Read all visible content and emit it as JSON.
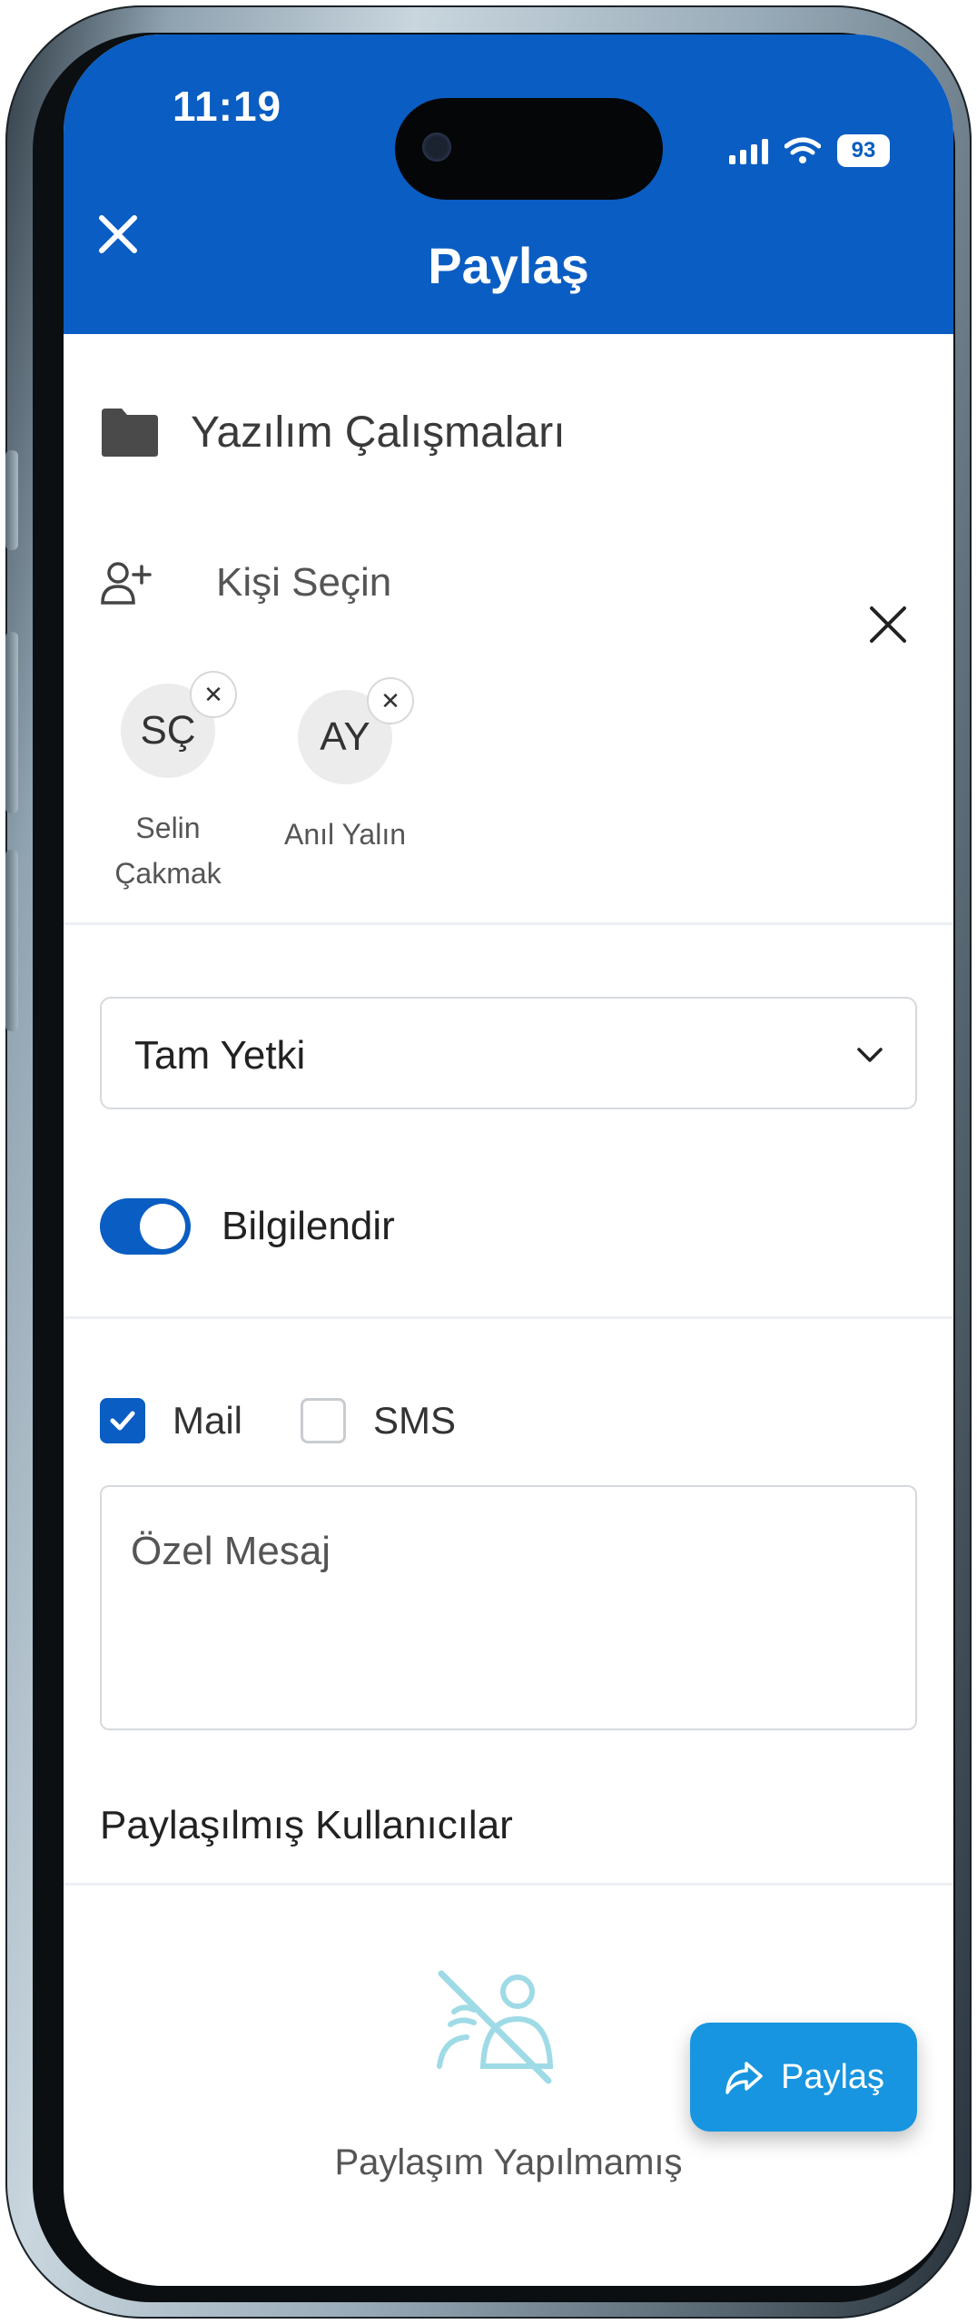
{
  "status_bar": {
    "time": "11:19",
    "battery": "93"
  },
  "header": {
    "title": "Paylaş"
  },
  "folder": {
    "name": "Yazılım Çalışmaları"
  },
  "recipients": {
    "select_label": "Kişi Seçin",
    "selected": [
      {
        "initials": "SÇ",
        "name_line1": "Selin",
        "name_line2": "Çakmak"
      },
      {
        "initials": "AY",
        "name_line1": "Anıl Yalın",
        "name_line2": ""
      }
    ]
  },
  "permission": {
    "selected": "Tam Yetki"
  },
  "notify": {
    "label": "Bilgilendir",
    "enabled": true
  },
  "channels": [
    {
      "label": "Mail",
      "checked": true
    },
    {
      "label": "SMS",
      "checked": false
    }
  ],
  "message": {
    "placeholder": "Özel Mesaj"
  },
  "shared_users": {
    "title": "Paylaşılmış Kullanıcılar",
    "empty_text": "Paylaşım Yapılmamış"
  },
  "fab": {
    "label": "Paylaş"
  },
  "colors": {
    "primary": "#0a5dc2",
    "fab": "#1795e0",
    "empty_icon": "#9fdbe6"
  }
}
